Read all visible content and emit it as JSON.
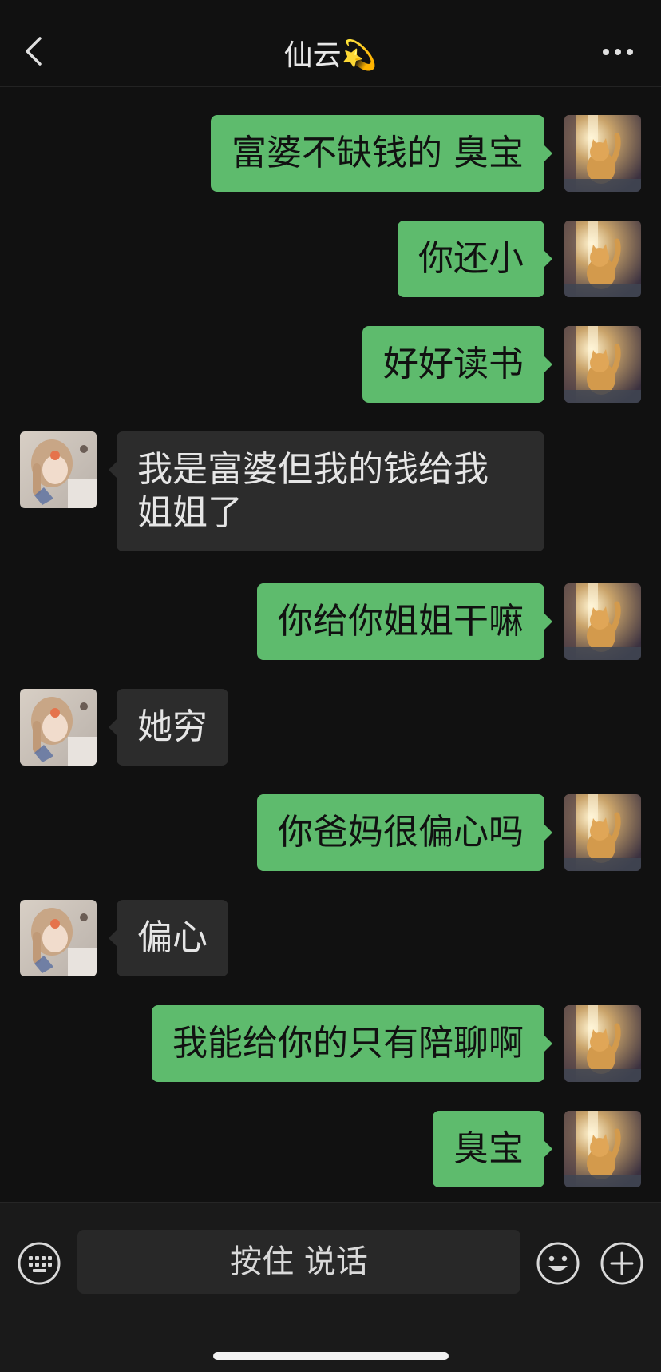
{
  "header": {
    "title": "仙云💫"
  },
  "messages": [
    {
      "side": "out",
      "text": "富婆不缺钱的 臭宝"
    },
    {
      "side": "out",
      "text": "你还小"
    },
    {
      "side": "out",
      "text": "好好读书"
    },
    {
      "side": "in",
      "text": "我是富婆但我的钱给我\n姐姐了"
    },
    {
      "side": "out",
      "text": "你给你姐姐干嘛"
    },
    {
      "side": "in",
      "text": "她穷"
    },
    {
      "side": "out",
      "text": "你爸妈很偏心吗"
    },
    {
      "side": "in",
      "text": "偏心"
    },
    {
      "side": "out",
      "text": "我能给你的只有陪聊啊"
    },
    {
      "side": "out",
      "text": "臭宝"
    }
  ],
  "input": {
    "voice_label": "按住 说话"
  },
  "icons": {
    "back": "chevron-left-icon",
    "more": "more-dots-icon",
    "keyboard": "keyboard-icon",
    "emoji": "emoji-icon",
    "add": "plus-icon"
  },
  "colors": {
    "background": "#111111",
    "outgoing_bubble": "#5ebb6d",
    "incoming_bubble": "#2c2c2c"
  }
}
